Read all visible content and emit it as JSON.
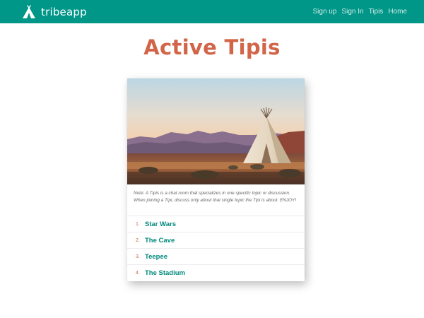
{
  "navbar": {
    "brand": "tribeapp",
    "brand_icon": "tipi-icon",
    "links": [
      "Sign up",
      "Sign In",
      "Tipis",
      "Home"
    ]
  },
  "page": {
    "title": "Active Tipis"
  },
  "card": {
    "image": "tipi-photo",
    "note": "Note: A Tipis is a chat room that specializes in one specific topic or discussion. When joining a Tipi, discuss only about that single topic the Tipi is about. ENJOY!",
    "tipis": [
      {
        "number": "1.",
        "name": "Star Wars"
      },
      {
        "number": "2.",
        "name": "The Cave"
      },
      {
        "number": "3.",
        "name": "Teepee"
      },
      {
        "number": "4.",
        "name": "The Stadium"
      }
    ]
  },
  "colors": {
    "navbar": "#009688",
    "title": "#d26447",
    "link": "#00897b"
  }
}
